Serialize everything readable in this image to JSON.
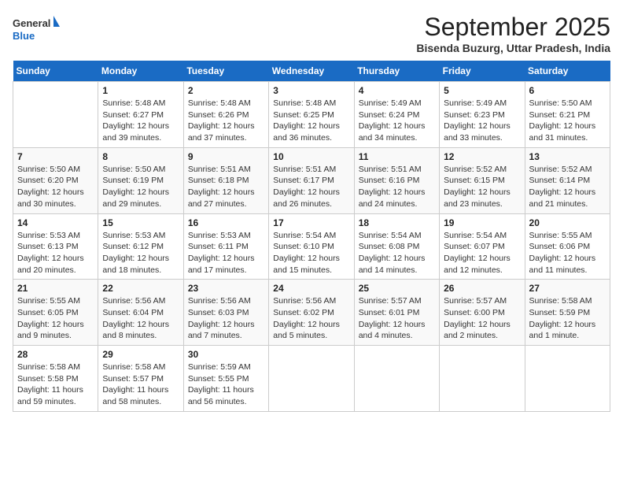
{
  "header": {
    "logo_line1": "General",
    "logo_line2": "Blue",
    "month": "September 2025",
    "location": "Bisenda Buzurg, Uttar Pradesh, India"
  },
  "weekdays": [
    "Sunday",
    "Monday",
    "Tuesday",
    "Wednesday",
    "Thursday",
    "Friday",
    "Saturday"
  ],
  "weeks": [
    [
      null,
      {
        "day": 1,
        "sunrise": "5:48 AM",
        "sunset": "6:27 PM",
        "daylight": "12 hours and 39 minutes."
      },
      {
        "day": 2,
        "sunrise": "5:48 AM",
        "sunset": "6:26 PM",
        "daylight": "12 hours and 37 minutes."
      },
      {
        "day": 3,
        "sunrise": "5:48 AM",
        "sunset": "6:25 PM",
        "daylight": "12 hours and 36 minutes."
      },
      {
        "day": 4,
        "sunrise": "5:49 AM",
        "sunset": "6:24 PM",
        "daylight": "12 hours and 34 minutes."
      },
      {
        "day": 5,
        "sunrise": "5:49 AM",
        "sunset": "6:23 PM",
        "daylight": "12 hours and 33 minutes."
      },
      {
        "day": 6,
        "sunrise": "5:50 AM",
        "sunset": "6:21 PM",
        "daylight": "12 hours and 31 minutes."
      }
    ],
    [
      {
        "day": 7,
        "sunrise": "5:50 AM",
        "sunset": "6:20 PM",
        "daylight": "12 hours and 30 minutes."
      },
      {
        "day": 8,
        "sunrise": "5:50 AM",
        "sunset": "6:19 PM",
        "daylight": "12 hours and 29 minutes."
      },
      {
        "day": 9,
        "sunrise": "5:51 AM",
        "sunset": "6:18 PM",
        "daylight": "12 hours and 27 minutes."
      },
      {
        "day": 10,
        "sunrise": "5:51 AM",
        "sunset": "6:17 PM",
        "daylight": "12 hours and 26 minutes."
      },
      {
        "day": 11,
        "sunrise": "5:51 AM",
        "sunset": "6:16 PM",
        "daylight": "12 hours and 24 minutes."
      },
      {
        "day": 12,
        "sunrise": "5:52 AM",
        "sunset": "6:15 PM",
        "daylight": "12 hours and 23 minutes."
      },
      {
        "day": 13,
        "sunrise": "5:52 AM",
        "sunset": "6:14 PM",
        "daylight": "12 hours and 21 minutes."
      }
    ],
    [
      {
        "day": 14,
        "sunrise": "5:53 AM",
        "sunset": "6:13 PM",
        "daylight": "12 hours and 20 minutes."
      },
      {
        "day": 15,
        "sunrise": "5:53 AM",
        "sunset": "6:12 PM",
        "daylight": "12 hours and 18 minutes."
      },
      {
        "day": 16,
        "sunrise": "5:53 AM",
        "sunset": "6:11 PM",
        "daylight": "12 hours and 17 minutes."
      },
      {
        "day": 17,
        "sunrise": "5:54 AM",
        "sunset": "6:10 PM",
        "daylight": "12 hours and 15 minutes."
      },
      {
        "day": 18,
        "sunrise": "5:54 AM",
        "sunset": "6:08 PM",
        "daylight": "12 hours and 14 minutes."
      },
      {
        "day": 19,
        "sunrise": "5:54 AM",
        "sunset": "6:07 PM",
        "daylight": "12 hours and 12 minutes."
      },
      {
        "day": 20,
        "sunrise": "5:55 AM",
        "sunset": "6:06 PM",
        "daylight": "12 hours and 11 minutes."
      }
    ],
    [
      {
        "day": 21,
        "sunrise": "5:55 AM",
        "sunset": "6:05 PM",
        "daylight": "12 hours and 9 minutes."
      },
      {
        "day": 22,
        "sunrise": "5:56 AM",
        "sunset": "6:04 PM",
        "daylight": "12 hours and 8 minutes."
      },
      {
        "day": 23,
        "sunrise": "5:56 AM",
        "sunset": "6:03 PM",
        "daylight": "12 hours and 7 minutes."
      },
      {
        "day": 24,
        "sunrise": "5:56 AM",
        "sunset": "6:02 PM",
        "daylight": "12 hours and 5 minutes."
      },
      {
        "day": 25,
        "sunrise": "5:57 AM",
        "sunset": "6:01 PM",
        "daylight": "12 hours and 4 minutes."
      },
      {
        "day": 26,
        "sunrise": "5:57 AM",
        "sunset": "6:00 PM",
        "daylight": "12 hours and 2 minutes."
      },
      {
        "day": 27,
        "sunrise": "5:58 AM",
        "sunset": "5:59 PM",
        "daylight": "12 hours and 1 minute."
      }
    ],
    [
      {
        "day": 28,
        "sunrise": "5:58 AM",
        "sunset": "5:58 PM",
        "daylight": "11 hours and 59 minutes."
      },
      {
        "day": 29,
        "sunrise": "5:58 AM",
        "sunset": "5:57 PM",
        "daylight": "11 hours and 58 minutes."
      },
      {
        "day": 30,
        "sunrise": "5:59 AM",
        "sunset": "5:55 PM",
        "daylight": "11 hours and 56 minutes."
      },
      null,
      null,
      null,
      null
    ]
  ]
}
